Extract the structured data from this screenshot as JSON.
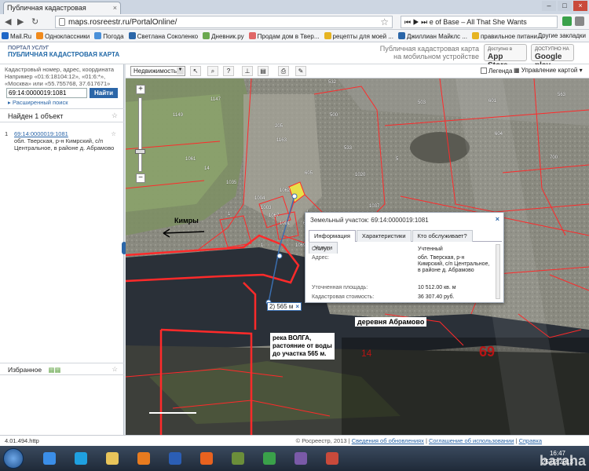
{
  "browser": {
    "tab_title": "Публичная кадастровая",
    "tab_close": "×",
    "url": "maps.rosreestr.ru/PortalOnline/",
    "media_title": "e of Base – All That She Wants",
    "window_buttons": [
      "–",
      "□",
      "×"
    ]
  },
  "bookmarks": {
    "items": [
      {
        "label": "Mail.Ru",
        "color": "#1f67c7"
      },
      {
        "label": "Одноклассники",
        "color": "#f08a1c"
      },
      {
        "label": "Погода",
        "color": "#4a90d9"
      },
      {
        "label": "Светлана Соколенко",
        "color": "#2b66a8"
      },
      {
        "label": "Дневник.ру",
        "color": "#6aa84f"
      },
      {
        "label": "Продам дом в Твер...",
        "color": "#e06666"
      },
      {
        "label": "рецепты для моей ...",
        "color": "#e6b422"
      },
      {
        "label": "Джиллиан Майклс ...",
        "color": "#2b66a8"
      },
      {
        "label": "правильное питани...",
        "color": "#e6b422"
      }
    ],
    "other": "Другие закладки"
  },
  "site": {
    "portal_label": "ПОРТАЛ УСЛУГ",
    "map_title": "ПУБЛИЧНАЯ КАДАСТРОВАЯ КАРТА",
    "mobile_text_1": "Публичная кадастровая карта",
    "mobile_text_2": "на мобильном устройстве",
    "appstore_small": "Доступно в",
    "appstore_big": "App Store",
    "gplay_small": "ДОСТУПНО НА",
    "gplay_big": "Google play"
  },
  "search": {
    "hint_1": "Кадастровый номер, адрес, координата",
    "hint_2": "Например «01:6:18104:12», «01:6:*»,",
    "hint_3": "«Москва» или «55.755768, 37.617671»",
    "query": "69:14:0000019:1081",
    "button": "Найти",
    "advanced": "▸ Расширенный поиск"
  },
  "results": {
    "found": "Найден 1 объект",
    "items": [
      {
        "num": "1",
        "id": "69:14:0000019:1081",
        "address": "обл. Тверская, р-н Кимрский, с/п Центральное, в районе д. Абрамово"
      }
    ]
  },
  "favorites": {
    "label": "Избранное"
  },
  "toolbar": {
    "layer": "Недвижимость",
    "legend": "Легенда",
    "management": "Управление картой"
  },
  "map": {
    "kimry": "Кимры",
    "village": "деревня Абрамово",
    "annotation": [
      "река ВОЛГА,",
      "растояние от воды",
      "до участка 565 м."
    ],
    "distance": "2) 565 м",
    "distance_close": "×",
    "big69": "69",
    "num14": "14",
    "parcel_labels": [
      "532",
      "1147",
      "1149",
      "205",
      "601",
      "563",
      "1061",
      "533",
      "5",
      "1163",
      "1062",
      "1003",
      "1",
      "1001",
      "69:...",
      "14",
      "1",
      "1",
      "605",
      "1069",
      "1020",
      "1037",
      "503",
      "500",
      "1004",
      "1067",
      "700",
      "604",
      "1035"
    ]
  },
  "popup": {
    "title": "Земельный участок: 69:14:0000019:1081",
    "close": "×",
    "tabs": [
      "Информация",
      "Характеристики",
      "Кто обслуживает?",
      "Услуги"
    ],
    "rows": [
      {
        "label": "Статус:",
        "value": "Учтенный"
      },
      {
        "label": "Адрес:",
        "value": "обл. Тверская, р-н Кимрский, с/п Центральное, в районе д. Абрамово"
      },
      {
        "label": "Уточненная площадь:",
        "value": "10 512.00 кв. м"
      },
      {
        "label": "Кадастровая стоимость:",
        "value": "36 307.40 руб."
      }
    ]
  },
  "status": {
    "left": "4.01.494.http",
    "copyright": "© Росреестр, 2013 |",
    "updates": "Сведения об обновлениях",
    "terms": "Соглашение об использовании",
    "help": "Справка"
  },
  "taskbar": {
    "apps": [
      {
        "name": "ie",
        "color": "#3b8ee8"
      },
      {
        "name": "skype",
        "color": "#1fa0e0"
      },
      {
        "name": "explorer",
        "color": "#e8c45a"
      },
      {
        "name": "media",
        "color": "#e87b1f"
      },
      {
        "name": "word",
        "color": "#2b5eb5"
      },
      {
        "name": "firefox",
        "color": "#e8621f"
      },
      {
        "name": "photo",
        "color": "#6b8e3a"
      },
      {
        "name": "chrome",
        "color": "#3aa14a"
      },
      {
        "name": "app",
        "color": "#7a5aa8"
      },
      {
        "name": "flag",
        "color": "#c94a3b"
      }
    ],
    "time": "16:47",
    "date": "25.02.2013",
    "watermark": "baraha"
  },
  "colors": {
    "boundary": "#ff2a2a",
    "highlight": "#e8e04a",
    "link": "#2b66a8"
  }
}
